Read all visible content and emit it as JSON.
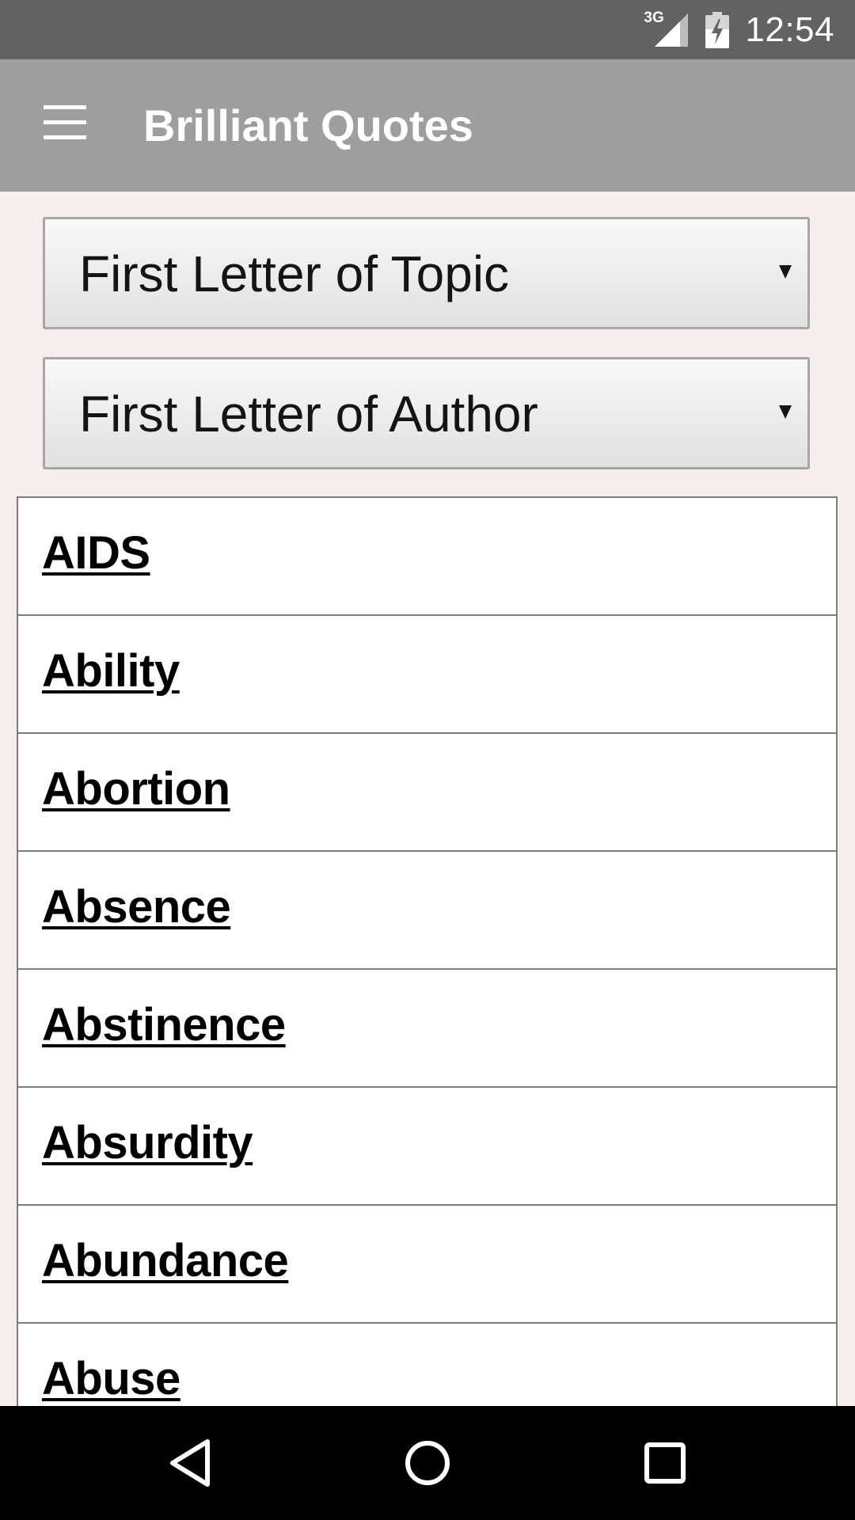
{
  "status_bar": {
    "network_type": "3G",
    "time": "12:54",
    "icons": [
      "signal-icon",
      "battery-charging-icon"
    ]
  },
  "app_bar": {
    "title": "Brilliant Quotes",
    "menu_icon": "hamburger-menu-icon"
  },
  "filters": {
    "topic_select": {
      "selected": "First Letter of Topic"
    },
    "author_select": {
      "selected": "First Letter of Author"
    }
  },
  "topics": [
    {
      "label": "AIDS"
    },
    {
      "label": "Ability"
    },
    {
      "label": "Abortion"
    },
    {
      "label": "Absence"
    },
    {
      "label": "Abstinence"
    },
    {
      "label": "Absurdity"
    },
    {
      "label": "Abundance"
    },
    {
      "label": "Abuse"
    }
  ],
  "navigation": {
    "icons": [
      "back-icon",
      "home-icon",
      "recents-icon"
    ]
  },
  "colors": {
    "status_bar": "#626262",
    "app_bar": "#9e9e9e",
    "background": "#f6eeec",
    "nav_bar": "#000000"
  }
}
